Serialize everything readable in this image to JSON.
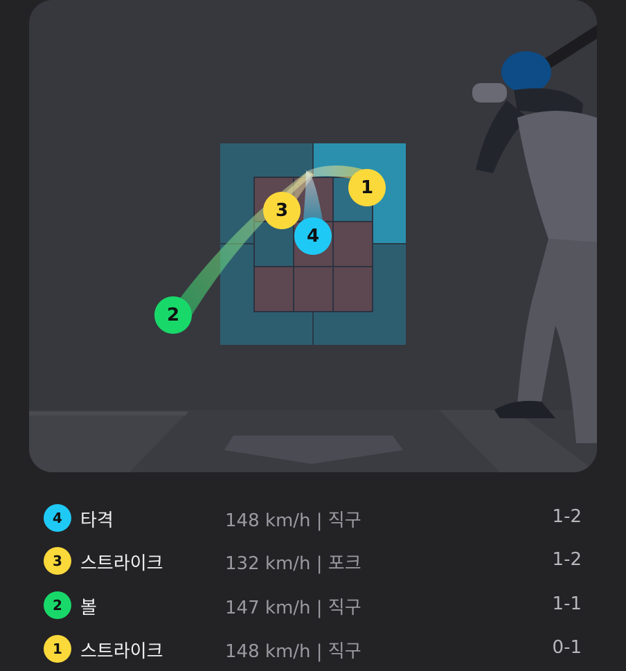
{
  "colors": {
    "strike": "#fbd93b",
    "ball": "#19d86a",
    "hit": "#1fc9f5",
    "zone_outer": "#2d5e70",
    "zone_highlight": "#2a90ae",
    "zone_inner": "#5d4750"
  },
  "pitches_on_plot": [
    {
      "num": "1",
      "type": "strike"
    },
    {
      "num": "2",
      "type": "ball"
    },
    {
      "num": "3",
      "type": "strike"
    },
    {
      "num": "4",
      "type": "hit"
    }
  ],
  "pitch_log": [
    {
      "num": "4",
      "result": "타격",
      "info": "148 km/h | 직구",
      "count": "1-2",
      "type": "hit"
    },
    {
      "num": "3",
      "result": "스트라이크",
      "info": "132 km/h | 포크",
      "count": "1-2",
      "type": "strike"
    },
    {
      "num": "2",
      "result": "볼",
      "info": "147 km/h | 직구",
      "count": "1-1",
      "type": "ball"
    },
    {
      "num": "1",
      "result": "스트라이크",
      "info": "148 km/h | 직구",
      "count": "0-1",
      "type": "strike"
    }
  ]
}
